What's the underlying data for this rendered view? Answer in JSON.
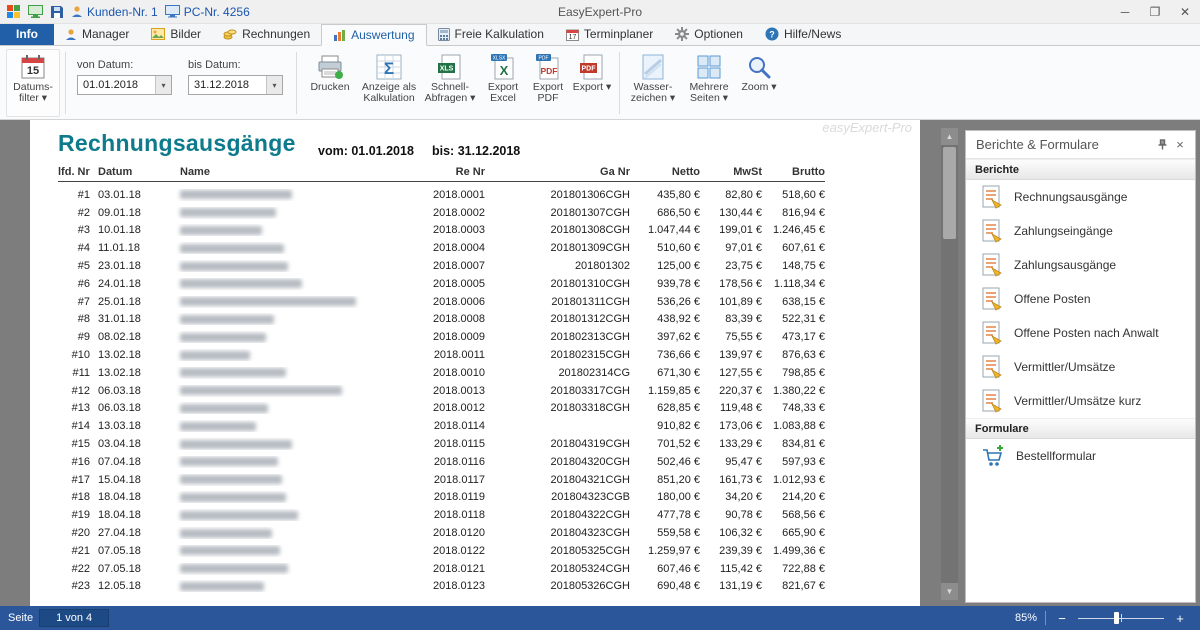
{
  "titlebar": {
    "customer": "Kunden-Nr. 1",
    "pc": "PC-Nr. 4256",
    "title": "EasyExpert-Pro"
  },
  "tabs": [
    {
      "label": "Info"
    },
    {
      "label": "Manager"
    },
    {
      "label": "Bilder"
    },
    {
      "label": "Rechnungen"
    },
    {
      "label": "Auswertung"
    },
    {
      "label": "Freie Kalkulation"
    },
    {
      "label": "Terminplaner"
    },
    {
      "label": "Optionen"
    },
    {
      "label": "Hilfe/News"
    }
  ],
  "ribbon": {
    "datumsfilter_label": "Datums-filter ▾",
    "calendar_day": "15",
    "von_label": "von Datum:",
    "von_value": "01.01.2018",
    "bis_label": "bis Datum:",
    "bis_value": "31.12.2018",
    "drucken": "Drucken",
    "anzeige": "Anzeige als Kalkulation",
    "schnellabfragen": "Schnell-Abfragen ▾",
    "export_excel": "Export Excel",
    "export_pdf": "Export PDF",
    "export": "Export ▾",
    "wasserzeichen": "Wasser-zeichen ▾",
    "mehrere_seiten": "Mehrere Seiten ▾",
    "zoom": "Zoom ▾"
  },
  "report": {
    "title": "Rechnungsausgänge",
    "vom": "vom: 01.01.2018",
    "bis": "bis: 31.12.2018",
    "watermark": "easyExpert-Pro",
    "columns": {
      "nr": "lfd. Nr",
      "datum": "Datum",
      "name": "Name",
      "re": "Re Nr",
      "ga": "Ga Nr",
      "netto": "Netto",
      "mwst": "MwSt",
      "brutto": "Brutto"
    },
    "rows": [
      {
        "nr": "#1",
        "datum": "03.01.18",
        "name_w": 112,
        "re": "2018.0001",
        "ga": "201801306CGH",
        "netto": "435,80 €",
        "mwst": "82,80 €",
        "brutto": "518,60 €"
      },
      {
        "nr": "#2",
        "datum": "09.01.18",
        "name_w": 96,
        "re": "2018.0002",
        "ga": "201801307CGH",
        "netto": "686,50 €",
        "mwst": "130,44 €",
        "brutto": "816,94 €"
      },
      {
        "nr": "#3",
        "datum": "10.01.18",
        "name_w": 82,
        "re": "2018.0003",
        "ga": "201801308CGH",
        "netto": "1.047,44 €",
        "mwst": "199,01 €",
        "brutto": "1.246,45 €"
      },
      {
        "nr": "#4",
        "datum": "11.01.18",
        "name_w": 104,
        "re": "2018.0004",
        "ga": "201801309CGH",
        "netto": "510,60 €",
        "mwst": "97,01 €",
        "brutto": "607,61 €"
      },
      {
        "nr": "#5",
        "datum": "23.01.18",
        "name_w": 108,
        "re": "2018.0007",
        "ga": "201801302",
        "netto": "125,00 €",
        "mwst": "23,75 €",
        "brutto": "148,75 €"
      },
      {
        "nr": "#6",
        "datum": "24.01.18",
        "name_w": 122,
        "re": "2018.0005",
        "ga": "201801310CGH",
        "netto": "939,78 €",
        "mwst": "178,56 €",
        "brutto": "1.118,34 €"
      },
      {
        "nr": "#7",
        "datum": "25.01.18",
        "name_w": 176,
        "re": "2018.0006",
        "ga": "201801311CGH",
        "netto": "536,26 €",
        "mwst": "101,89 €",
        "brutto": "638,15 €"
      },
      {
        "nr": "#8",
        "datum": "31.01.18",
        "name_w": 94,
        "re": "2018.0008",
        "ga": "201801312CGH",
        "netto": "438,92 €",
        "mwst": "83,39 €",
        "brutto": "522,31 €"
      },
      {
        "nr": "#9",
        "datum": "08.02.18",
        "name_w": 86,
        "re": "2018.0009",
        "ga": "201802313CGH",
        "netto": "397,62 €",
        "mwst": "75,55 €",
        "brutto": "473,17 €"
      },
      {
        "nr": "#10",
        "datum": "13.02.18",
        "name_w": 70,
        "re": "2018.0011",
        "ga": "201802315CGH",
        "netto": "736,66 €",
        "mwst": "139,97 €",
        "brutto": "876,63 €"
      },
      {
        "nr": "#11",
        "datum": "13.02.18",
        "name_w": 106,
        "re": "2018.0010",
        "ga": "201802314CG",
        "netto": "671,30 €",
        "mwst": "127,55 €",
        "brutto": "798,85 €"
      },
      {
        "nr": "#12",
        "datum": "06.03.18",
        "name_w": 162,
        "re": "2018.0013",
        "ga": "201803317CGH",
        "netto": "1.159,85 €",
        "mwst": "220,37 €",
        "brutto": "1.380,22 €"
      },
      {
        "nr": "#13",
        "datum": "06.03.18",
        "name_w": 88,
        "re": "2018.0012",
        "ga": "201803318CGH",
        "netto": "628,85 €",
        "mwst": "119,48 €",
        "brutto": "748,33 €"
      },
      {
        "nr": "#14",
        "datum": "13.03.18",
        "name_w": 76,
        "re": "2018.0114",
        "ga": "",
        "netto": "910,82 €",
        "mwst": "173,06 €",
        "brutto": "1.083,88 €"
      },
      {
        "nr": "#15",
        "datum": "03.04.18",
        "name_w": 112,
        "re": "2018.0115",
        "ga": "201804319CGH",
        "netto": "701,52 €",
        "mwst": "133,29 €",
        "brutto": "834,81 €"
      },
      {
        "nr": "#16",
        "datum": "07.04.18",
        "name_w": 98,
        "re": "2018.0116",
        "ga": "201804320CGH",
        "netto": "502,46 €",
        "mwst": "95,47 €",
        "brutto": "597,93 €"
      },
      {
        "nr": "#17",
        "datum": "15.04.18",
        "name_w": 102,
        "re": "2018.0117",
        "ga": "201804321CGH",
        "netto": "851,20 €",
        "mwst": "161,73 €",
        "brutto": "1.012,93 €"
      },
      {
        "nr": "#18",
        "datum": "18.04.18",
        "name_w": 106,
        "re": "2018.0119",
        "ga": "201804323CGB",
        "netto": "180,00 €",
        "mwst": "34,20 €",
        "brutto": "214,20 €"
      },
      {
        "nr": "#19",
        "datum": "18.04.18",
        "name_w": 118,
        "re": "2018.0118",
        "ga": "201804322CGH",
        "netto": "477,78 €",
        "mwst": "90,78 €",
        "brutto": "568,56 €"
      },
      {
        "nr": "#20",
        "datum": "27.04.18",
        "name_w": 92,
        "re": "2018.0120",
        "ga": "201804323CGH",
        "netto": "559,58 €",
        "mwst": "106,32 €",
        "brutto": "665,90 €"
      },
      {
        "nr": "#21",
        "datum": "07.05.18",
        "name_w": 100,
        "re": "2018.0122",
        "ga": "201805325CGH",
        "netto": "1.259,97 €",
        "mwst": "239,39 €",
        "brutto": "1.499,36 €"
      },
      {
        "nr": "#22",
        "datum": "07.05.18",
        "name_w": 108,
        "re": "2018.0121",
        "ga": "201805324CGH",
        "netto": "607,46 €",
        "mwst": "115,42 €",
        "brutto": "722,88 €"
      },
      {
        "nr": "#23",
        "datum": "12.05.18",
        "name_w": 84,
        "re": "2018.0123",
        "ga": "201805326CGH",
        "netto": "690,48 €",
        "mwst": "131,19 €",
        "brutto": "821,67 €"
      }
    ]
  },
  "panel": {
    "title": "Berichte & Formulare",
    "berichte_header": "Berichte",
    "formulare_header": "Formulare",
    "berichte": [
      {
        "label": "Rechnungsausgänge"
      },
      {
        "label": "Zahlungseingänge"
      },
      {
        "label": "Zahlungsausgänge"
      },
      {
        "label": "Offene Posten"
      },
      {
        "label": "Offene Posten nach Anwalt"
      },
      {
        "label": "Vermittler/Umsätze"
      },
      {
        "label": "Vermittler/Umsätze kurz"
      }
    ],
    "formulare": [
      {
        "label": "Bestellformular"
      }
    ]
  },
  "statusbar": {
    "page_label": "Seite",
    "page_value": "1 von 4",
    "zoom_value": "85%"
  }
}
